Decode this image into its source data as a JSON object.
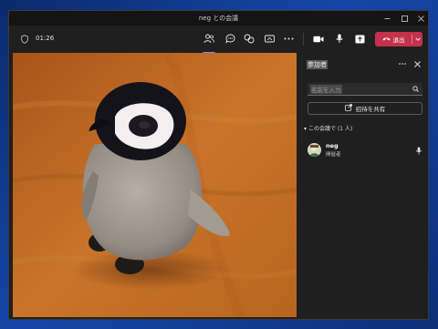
{
  "window": {
    "title": "neg との会議"
  },
  "toolbar": {
    "timer": "01:26",
    "leave_label": "退出"
  },
  "panel": {
    "title": "参加者",
    "search_placeholder": "名前を入力",
    "share_label": "招待を共有",
    "section_label": "この会議で (1 人)",
    "participants": [
      {
        "name": "neg",
        "role": "開催者"
      }
    ]
  },
  "colors": {
    "leave": "#c4314b",
    "accent": "#7f85f5",
    "window_bg": "#1f1f1f"
  },
  "icons": [
    "shield-icon",
    "people-icon",
    "chat-icon",
    "reactions-icon",
    "share-screen-icon",
    "more-icon",
    "camera-icon",
    "mic-icon",
    "share-tray-icon",
    "phone-icon",
    "chevron-down-icon",
    "close-icon",
    "search-icon",
    "person-add-icon",
    "minimize-icon",
    "maximize-icon",
    "window-close-icon"
  ]
}
